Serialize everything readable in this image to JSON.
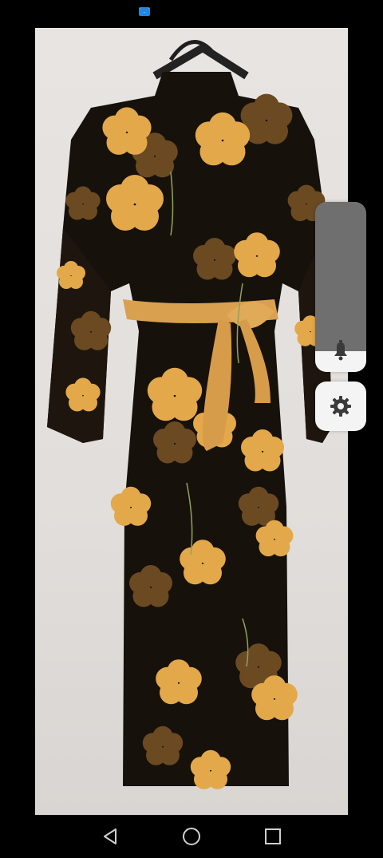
{
  "status_bar": {
    "notification_icons": [
      "mail-icon"
    ]
  },
  "photo": {
    "subject": "dress-on-hanger"
  },
  "volume_panel": {
    "level": 0.12,
    "colors": {
      "track": "#6f6f6f",
      "fill": "#f4f4f4",
      "icon": "#3a3a3a"
    },
    "icon": "bell-icon"
  },
  "settings_button": {
    "icon": "gear-icon"
  },
  "nav_bar": {
    "buttons": [
      "back-icon",
      "home-icon",
      "recents-icon"
    ],
    "color": "#cfcfcf"
  }
}
